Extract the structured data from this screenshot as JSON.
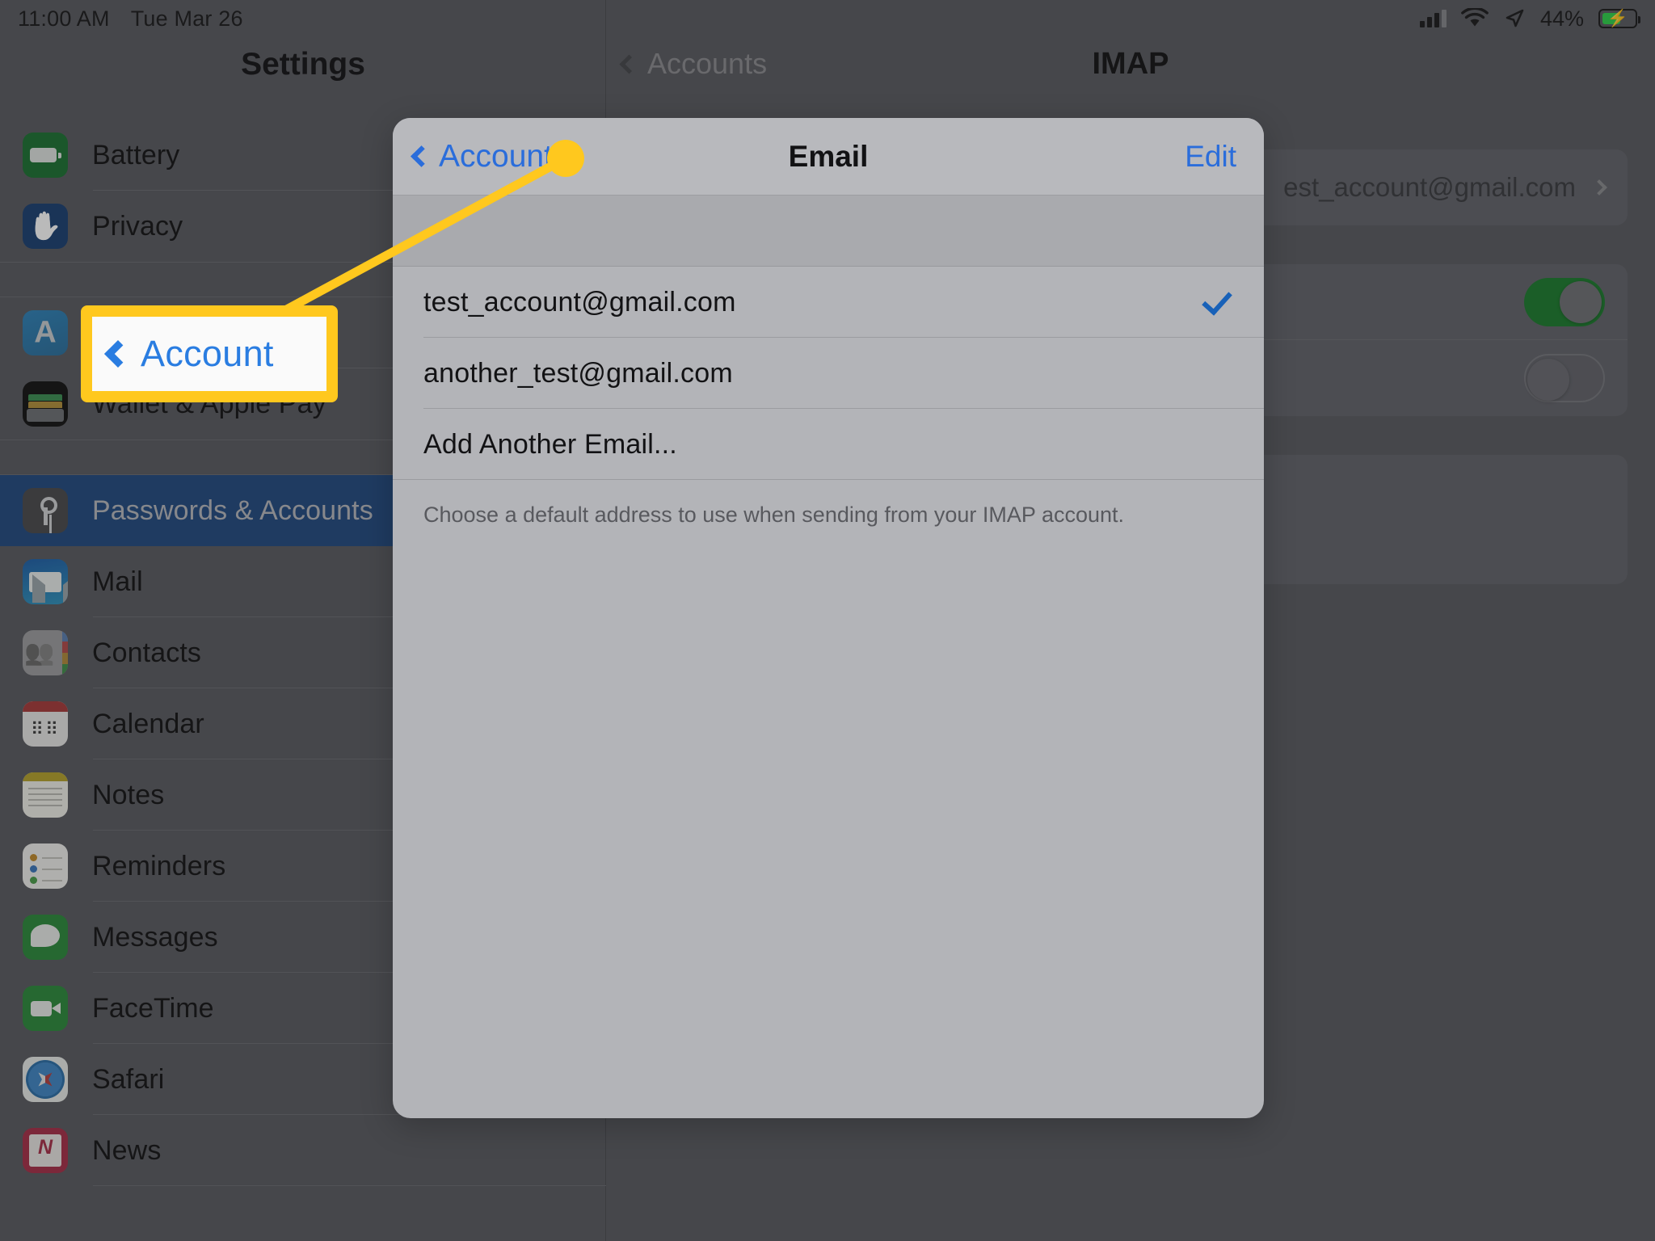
{
  "status_bar": {
    "time": "11:00 AM",
    "date": "Tue Mar 26",
    "battery_percent": "44%",
    "icons": [
      "cellular-signal-icon",
      "wifi-icon",
      "location-arrow-icon",
      "battery-charging-icon"
    ]
  },
  "sidebar": {
    "title": "Settings",
    "items": [
      {
        "label": "Battery",
        "icon": "battery-icon",
        "selected": false
      },
      {
        "label": "Privacy",
        "icon": "privacy-hand-icon",
        "selected": false
      },
      {
        "label": "iTunes & App Store",
        "icon": "app-store-icon",
        "selected": false,
        "hide_label": true
      },
      {
        "label": "Wallet & Apple Pay",
        "icon": "wallet-icon",
        "selected": false
      },
      {
        "label": "Passwords & Accounts",
        "icon": "key-icon",
        "selected": true
      },
      {
        "label": "Mail",
        "icon": "mail-icon",
        "selected": false
      },
      {
        "label": "Contacts",
        "icon": "contacts-icon",
        "selected": false
      },
      {
        "label": "Calendar",
        "icon": "calendar-icon",
        "selected": false
      },
      {
        "label": "Notes",
        "icon": "notes-icon",
        "selected": false
      },
      {
        "label": "Reminders",
        "icon": "reminders-icon",
        "selected": false
      },
      {
        "label": "Messages",
        "icon": "messages-icon",
        "selected": false
      },
      {
        "label": "FaceTime",
        "icon": "facetime-icon",
        "selected": false
      },
      {
        "label": "Safari",
        "icon": "safari-icon",
        "selected": false
      },
      {
        "label": "News",
        "icon": "news-icon",
        "selected": false
      }
    ]
  },
  "detail": {
    "back_label": "Accounts",
    "title": "IMAP",
    "email_row_value": "est_account@gmail.com",
    "toggle_on": "on",
    "toggle_off": "off"
  },
  "modal": {
    "back_label": "Account",
    "title": "Email",
    "edit_label": "Edit",
    "rows": [
      {
        "label": "test_account@gmail.com",
        "checked": true
      },
      {
        "label": "another_test@gmail.com",
        "checked": false
      },
      {
        "label": "Add Another Email...",
        "checked": false
      }
    ],
    "footer": "Choose a default address to use when sending from your IMAP account."
  },
  "callout": {
    "label": "Account",
    "color": "#ffc81e",
    "link_color": "#2a7de1"
  }
}
